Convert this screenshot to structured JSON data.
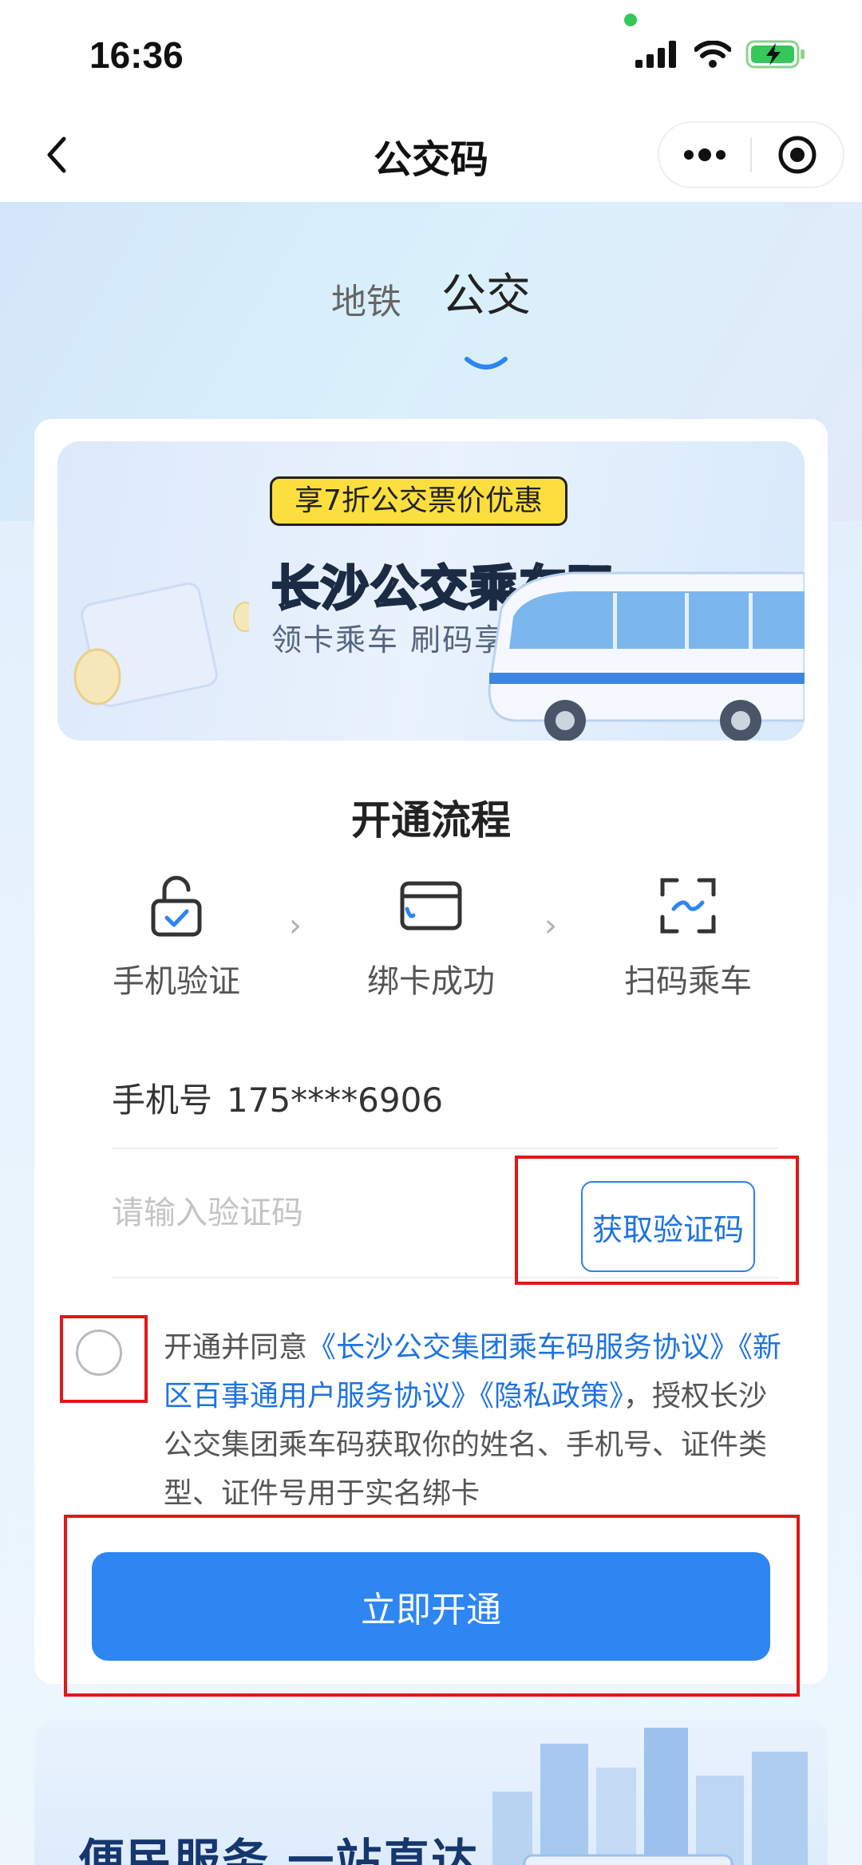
{
  "status_bar": {
    "time": "16:36"
  },
  "nav": {
    "title": "公交码"
  },
  "top_tabs": [
    {
      "label": "地铁",
      "active": false
    },
    {
      "label": "公交",
      "active": true
    }
  ],
  "banner": {
    "promo_tag": "享7折公交票价优惠",
    "title_main": "长沙公交",
    "title_accent": "乘车码",
    "subtitle": "领卡乘车  刷码享优惠"
  },
  "process": {
    "title": "开通流程",
    "steps": [
      {
        "label": "手机验证",
        "icon": "unlock-check-icon"
      },
      {
        "label": "绑卡成功",
        "icon": "card-icon"
      },
      {
        "label": "扫码乘车",
        "icon": "scan-icon"
      }
    ]
  },
  "form": {
    "phone_label": "手机号",
    "phone_value": "175****6906",
    "code_placeholder": "请输入验证码",
    "get_code_label": "获取验证码"
  },
  "agreement": {
    "prefix": "开通并同意",
    "link_1": "《长沙公交集团乘车码服务协议》",
    "link_2": "《新区百事通用户服务协议》",
    "link_3": "《隐私政策》",
    "suffix": "，授权长沙公交集团乘车码获取你的姓名、手机号、证件类型、证件号用于实名绑卡",
    "checked": false
  },
  "primary_button": {
    "label": "立即开通"
  },
  "service_section": {
    "title": "便民服务 一站直达"
  },
  "colors": {
    "accent_blue": "#2d86f1",
    "link_blue": "#1e73e0",
    "promo_yellow": "#fcdf3e",
    "highlight_red": "#e01818"
  }
}
